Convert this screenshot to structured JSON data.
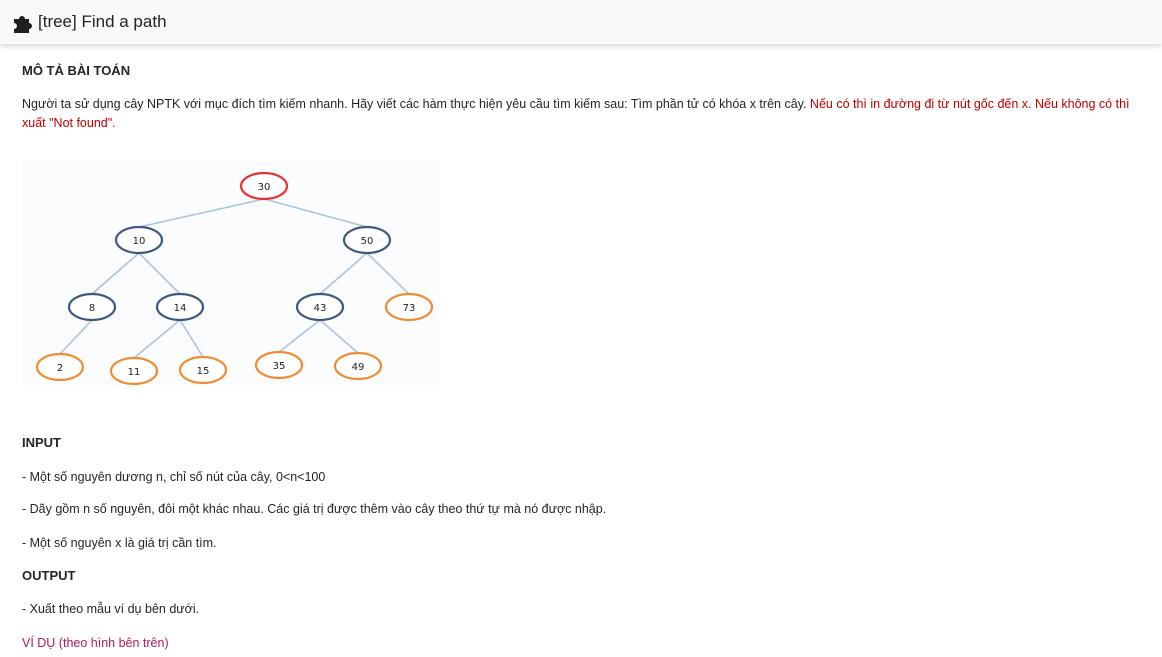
{
  "header": {
    "title": "[tree] Find a path",
    "icon": "puzzle-piece-icon"
  },
  "problem": {
    "heading": "MÔ TẢ BÀI TOÁN",
    "description_black": "Người ta sử dụng cây NPTK với mục đích tìm kiếm nhanh. Hãy viết các hàm thực hiện yêu cầu tìm kiếm sau: Tìm phần tử có khóa x trên cây. ",
    "description_red": "Nếu có thì in đường đi từ nút gốc đến x. Nếu không có thì xuất \"Not found\"."
  },
  "tree": {
    "nodes": [
      "30",
      "10",
      "50",
      "8",
      "14",
      "43",
      "73",
      "2",
      "11",
      "15",
      "35",
      "49"
    ],
    "colors": {
      "root": "#e8303a",
      "internal": "#3d5a80",
      "leaf": "#f08c33",
      "edge": "#a9c4dd"
    }
  },
  "input": {
    "heading": "INPUT",
    "lines": [
      "- Một số nguyên dương n, chỉ số nút của cây, 0<n<100",
      "- Dãy gồm n số nguyên, đôi một khác nhau. Các giá trị được thêm vào cây theo thứ tự mà nó được nhập.",
      "- Một số nguyên x là giá trị cần tìm."
    ]
  },
  "output": {
    "heading": "OUTPUT",
    "lines": [
      "- Xuất theo mẫu ví dụ bên dưới."
    ]
  },
  "example": {
    "label": "VÍ DỤ (theo hình bên trên)"
  }
}
